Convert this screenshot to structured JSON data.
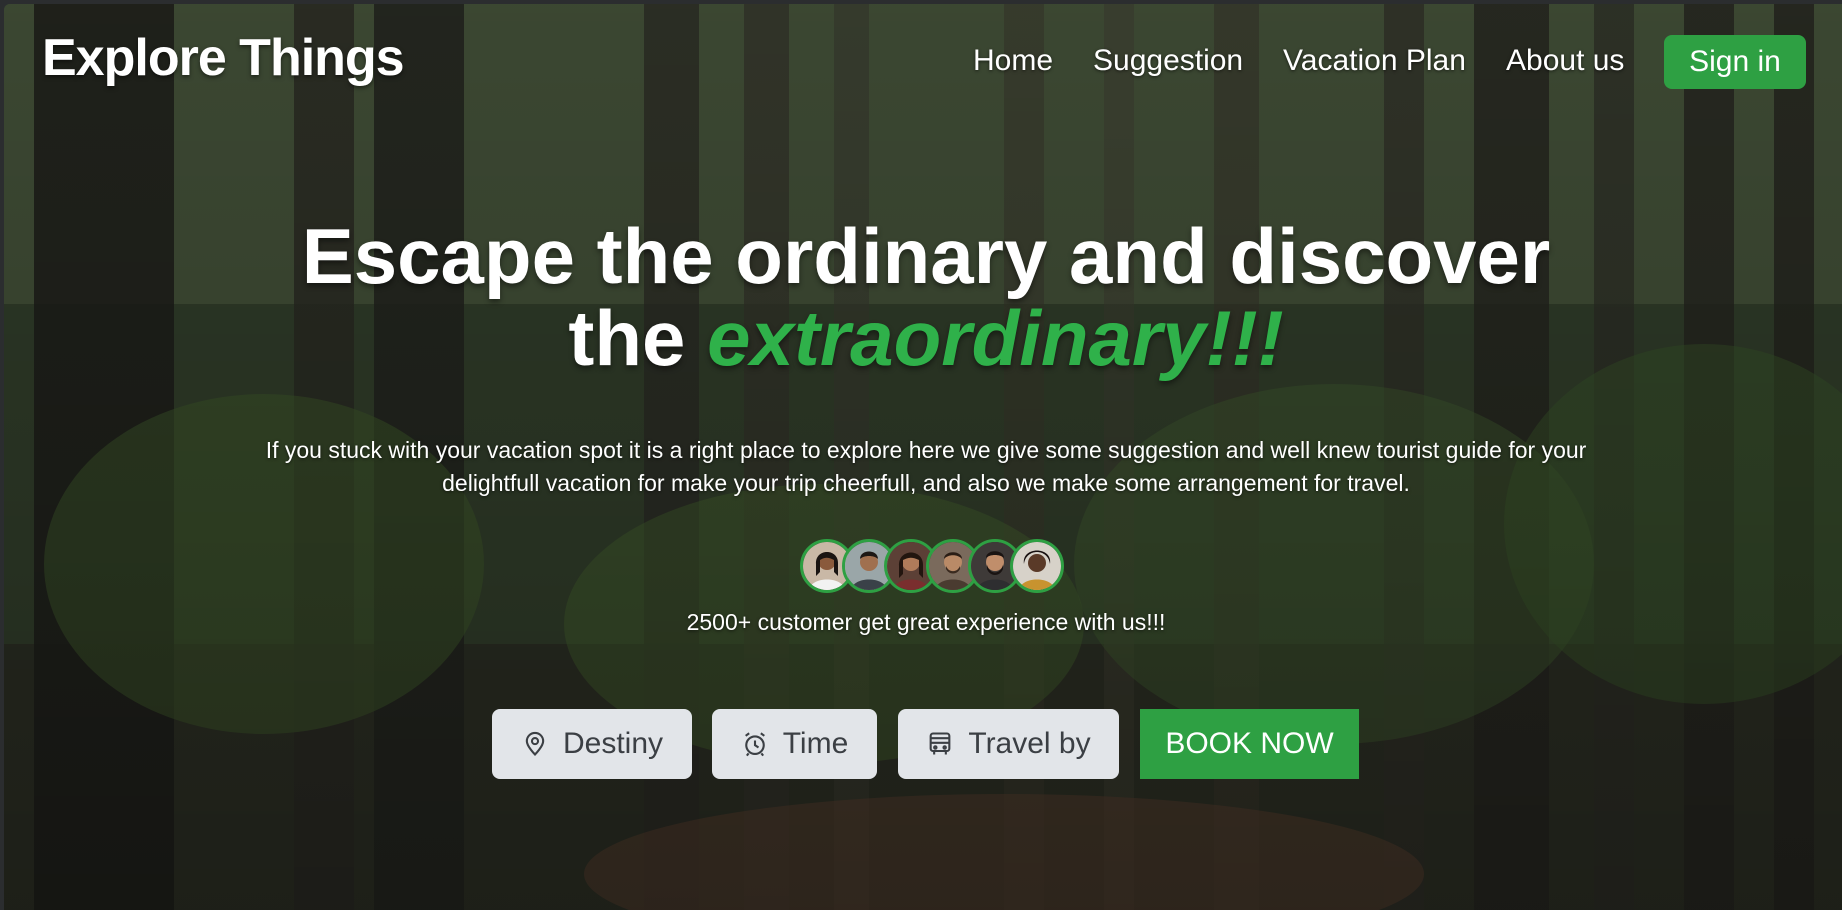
{
  "brand": {
    "name": "Explore Things",
    "accent_color": "#2ea043"
  },
  "nav": {
    "items": [
      {
        "label": "Home"
      },
      {
        "label": "Suggestion"
      },
      {
        "label": "Vacation Plan"
      },
      {
        "label": "About us"
      }
    ],
    "signin_label": "Sign in"
  },
  "hero": {
    "headline_line1": "Escape the ordinary and discover",
    "headline_line2_prefix": "the ",
    "headline_accent": "extraordinary!!!",
    "subtitle": "If you stuck with your vacation spot it is a right place to explore here we give some suggestion and well knew tourist guide for your delightfull vacation for make your trip cheerfull, and also we make some arrangement for travel.",
    "avatar_count": 6,
    "customers_text": "2500+ customer get great experience with us!!!"
  },
  "booking": {
    "destiny": {
      "label": "Destiny",
      "icon": "map-pin-icon"
    },
    "time": {
      "label": "Time",
      "icon": "alarm-clock-icon"
    },
    "travel": {
      "label": "Travel by",
      "icon": "bus-icon"
    },
    "book_label": "BOOK NOW"
  }
}
